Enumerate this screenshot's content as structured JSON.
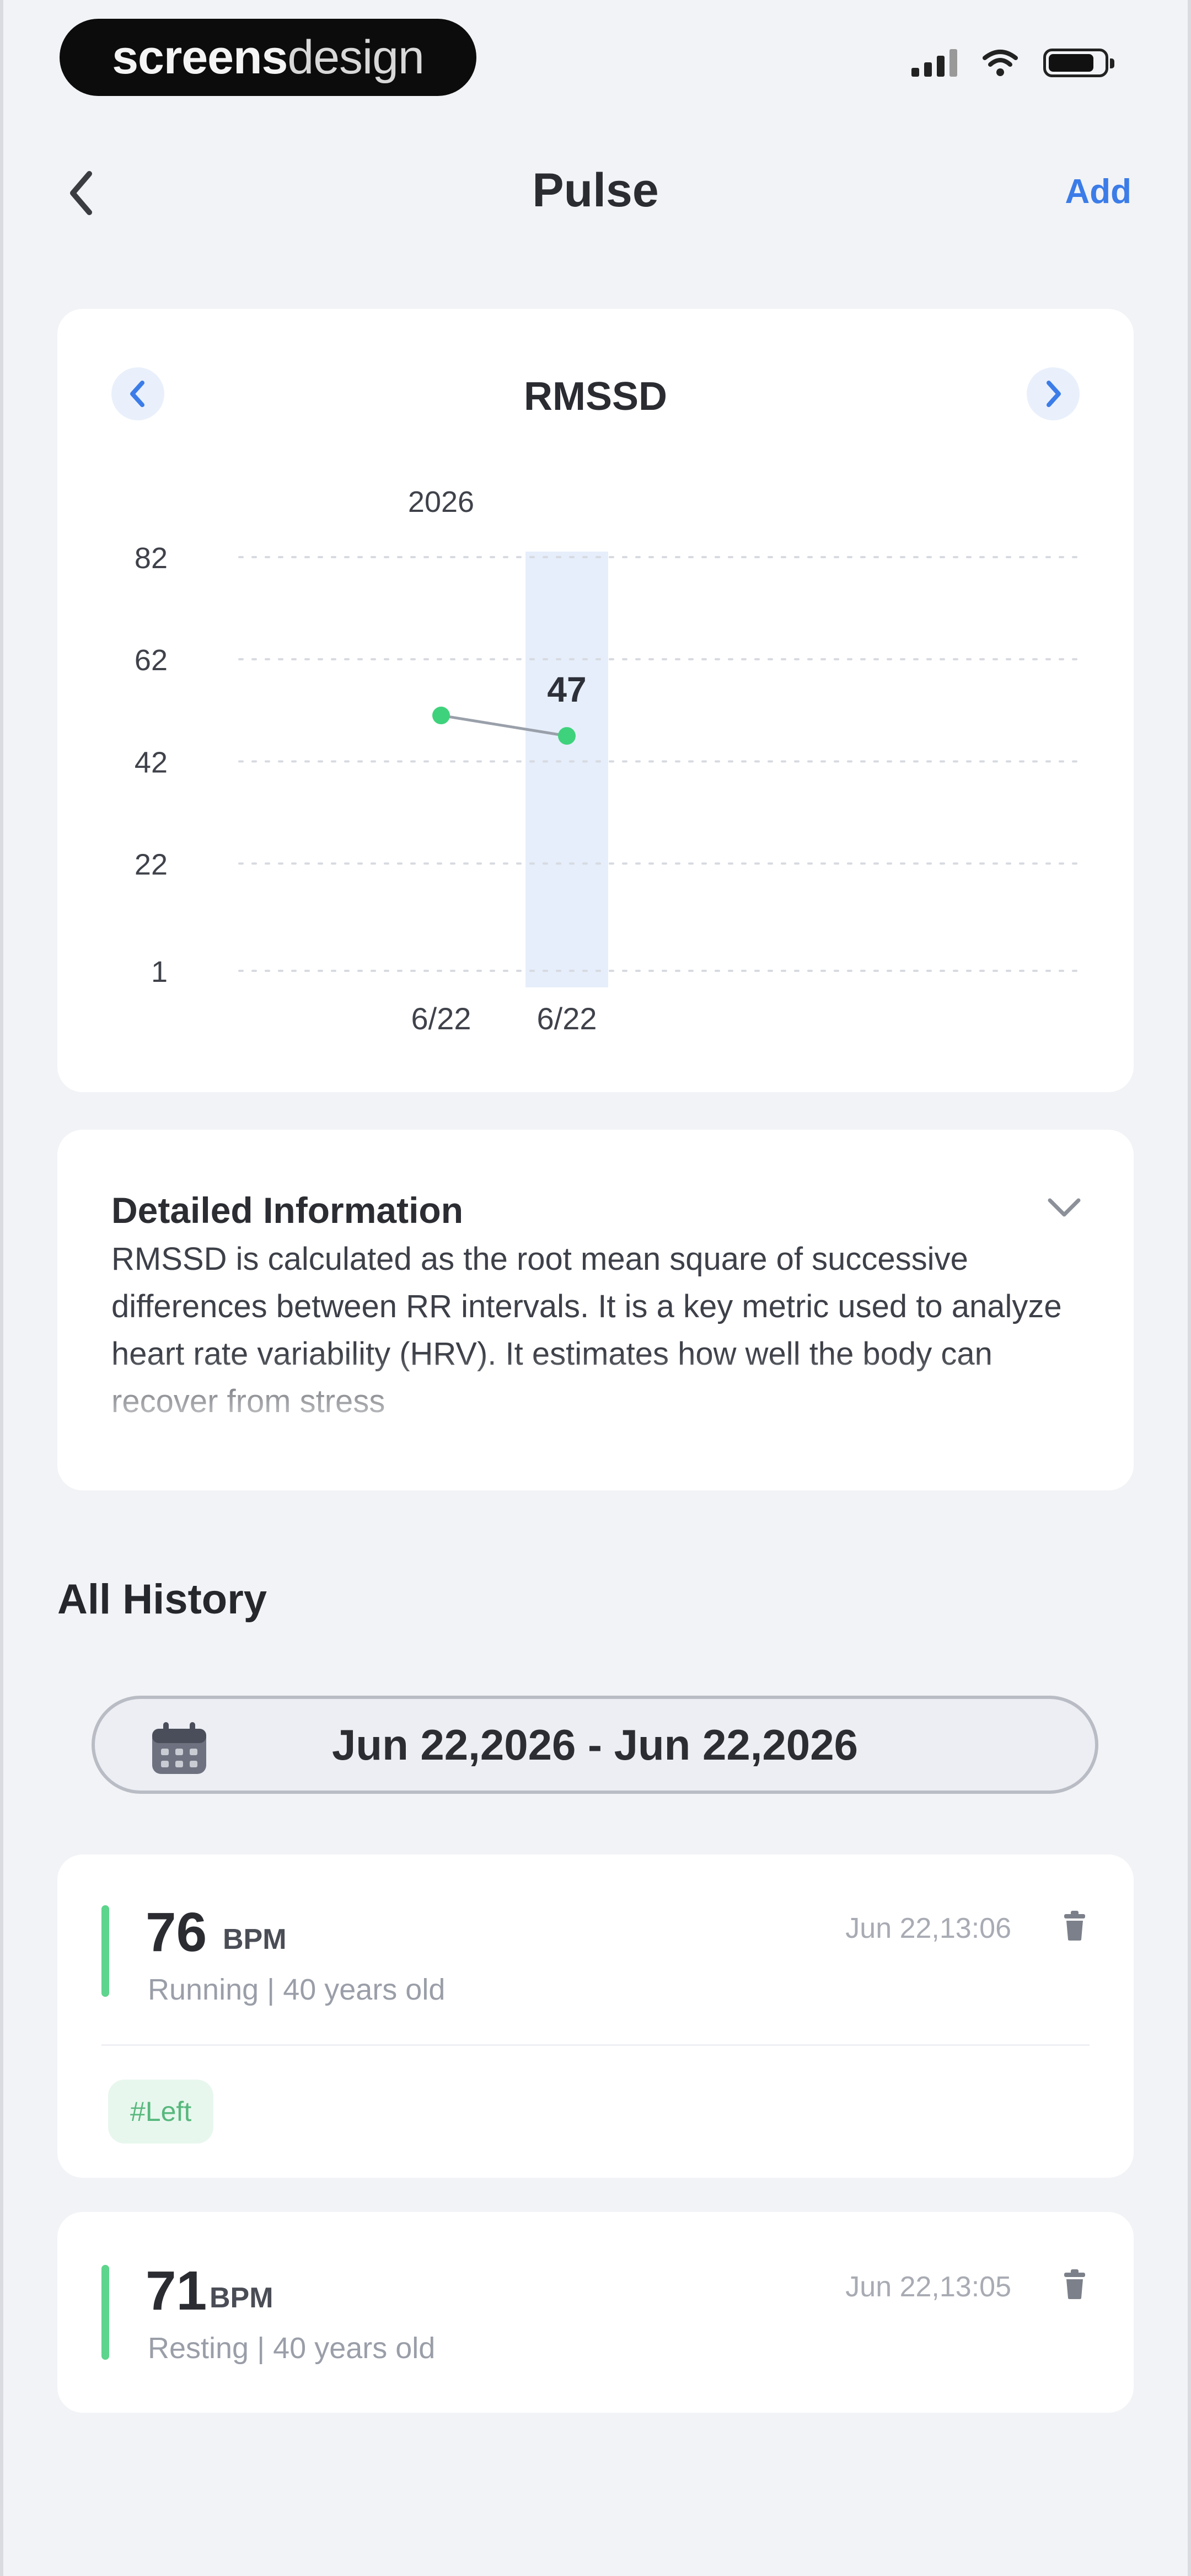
{
  "status_bar": {
    "brand_bold": "screens",
    "brand_light": "design"
  },
  "nav": {
    "title": "Pulse",
    "add_label": "Add"
  },
  "chart_data": {
    "type": "line",
    "title": "RMSSD",
    "year_label": "2026",
    "x": [
      "6/22",
      "6/22"
    ],
    "values": [
      51,
      47
    ],
    "highlight_index": 1,
    "highlight_label": "47",
    "yticks": [
      82,
      62,
      42,
      22,
      1
    ],
    "ylim": [
      1,
      82
    ],
    "grid": true,
    "colors": {
      "line": "#9aa0aa",
      "point": "#3fd27c",
      "highlight": "#e6eefb"
    }
  },
  "detail": {
    "title": "Detailed Information",
    "text": "RMSSD is calculated as the root mean square of successive differences between RR intervals. It is a key metric used to analyze heart rate variability (HRV). It estimates how well the body can recover from stress"
  },
  "history": {
    "heading": "All History",
    "date_range": "Jun 22,2026 - Jun 22,2026",
    "records": [
      {
        "value": "76",
        "unit": "BPM",
        "subtitle": "Running | 40 years old",
        "time": "Jun 22,13:06",
        "tag": "#Left"
      },
      {
        "value": "71",
        "unit": "BPM",
        "subtitle": "Resting | 40 years old",
        "time": "Jun 22,13:05"
      }
    ]
  },
  "colors": {
    "accent": "#3b7ce8",
    "status_green": "#5dd58c",
    "background": "#f2f3f6"
  }
}
